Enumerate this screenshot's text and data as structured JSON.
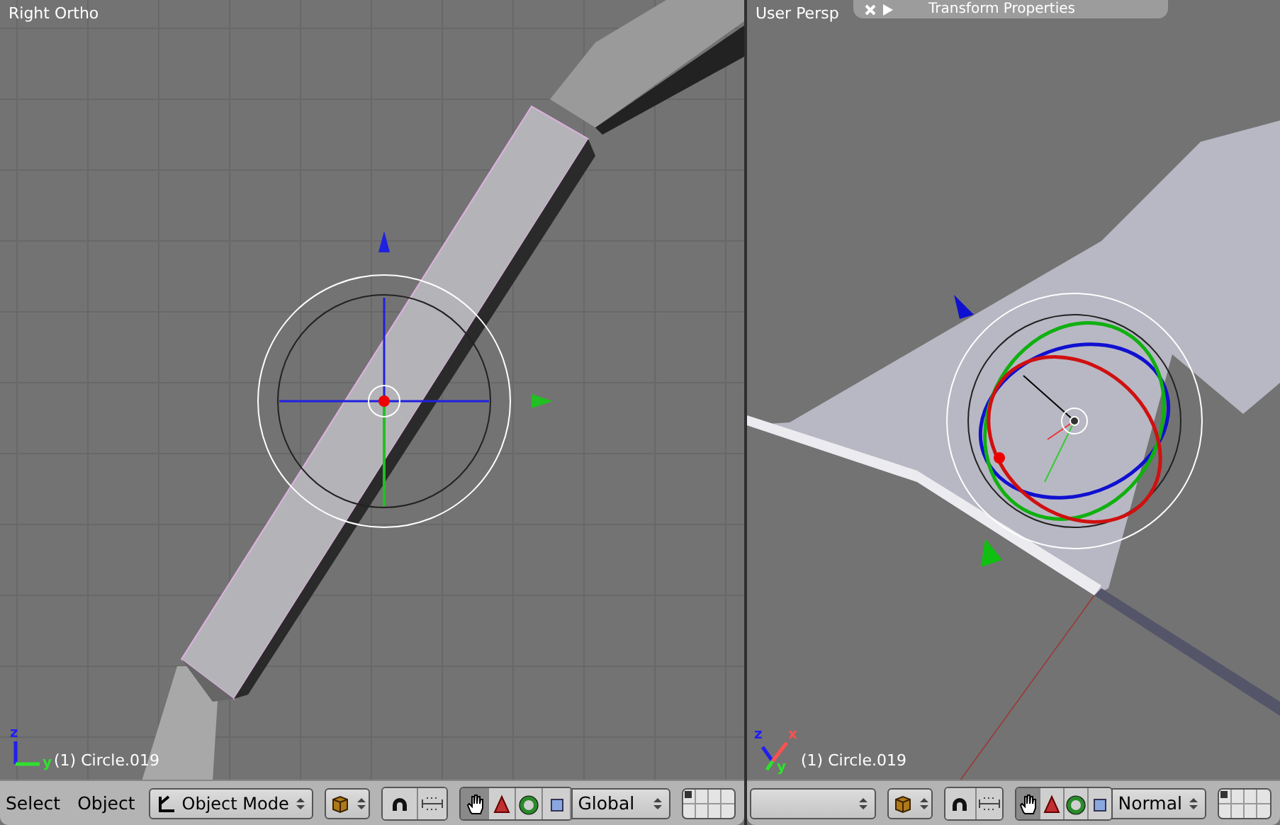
{
  "viewports": [
    {
      "kind": "ortho",
      "label": "Right Ortho",
      "object_label": "(1) Circle.019",
      "axes": [
        {
          "kind": "z",
          "label": "z"
        },
        {
          "kind": "y",
          "label": "y"
        }
      ],
      "header": {
        "menus": [
          "Select",
          "Object"
        ],
        "mode": "Object Mode",
        "orientation": "Global",
        "manipulators": [
          {
            "kind": "hand",
            "on": true
          },
          {
            "kind": "translate",
            "on": false
          },
          {
            "kind": "rotate",
            "on": false
          },
          {
            "kind": "scale",
            "on": false
          }
        ]
      }
    },
    {
      "kind": "persp",
      "label": "User Persp",
      "panel": {
        "title": "Transform Properties"
      },
      "object_label": "(1) Circle.019",
      "axes": [
        {
          "kind": "z",
          "label": "z"
        },
        {
          "kind": "x",
          "label": "x"
        },
        {
          "kind": "y",
          "label": "y"
        }
      ],
      "header": {
        "orientation": "Normal",
        "manipulators": [
          {
            "kind": "hand",
            "on": true
          },
          {
            "kind": "translate",
            "on": false
          },
          {
            "kind": "rotate",
            "on": false
          },
          {
            "kind": "scale",
            "on": false
          }
        ]
      }
    }
  ]
}
